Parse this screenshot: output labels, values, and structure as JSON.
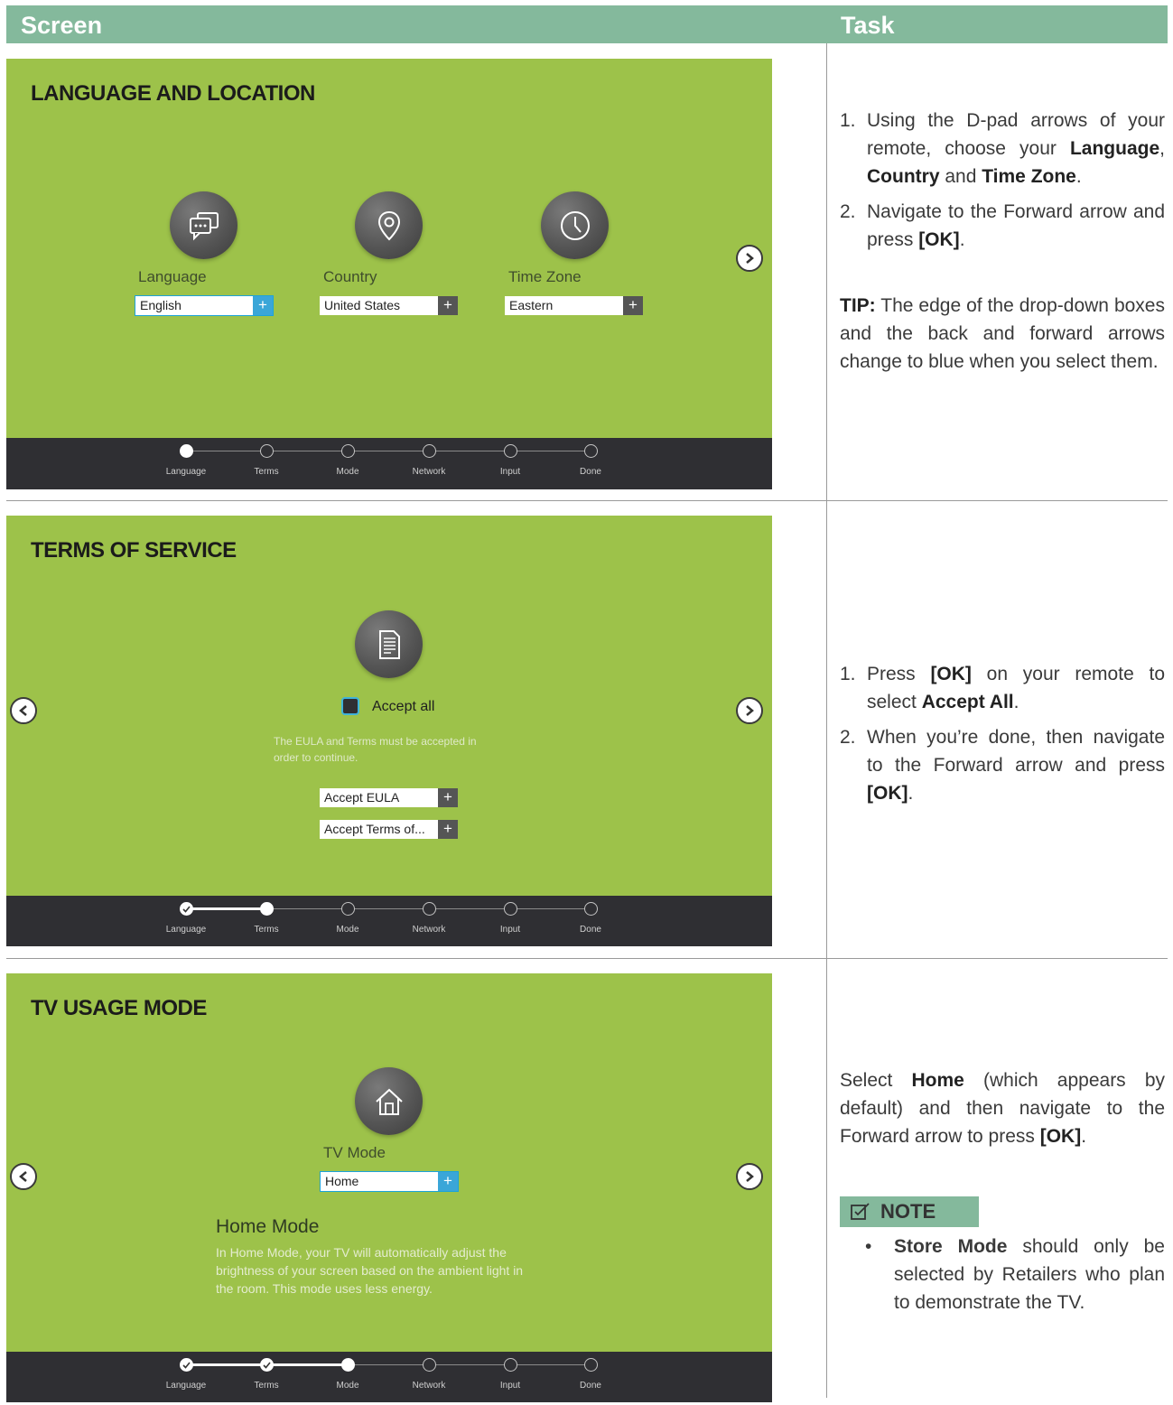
{
  "header": {
    "screen": "Screen",
    "task": "Task"
  },
  "steps": [
    "Language",
    "Terms",
    "Mode",
    "Network",
    "Input",
    "Done"
  ],
  "section1": {
    "title": "LANGUAGE AND LOCATION",
    "fields": [
      {
        "label": "Language",
        "value": "English",
        "icon": "chat-bubbles-icon"
      },
      {
        "label": "Country",
        "value": "United States",
        "icon": "location-pin-icon"
      },
      {
        "label": "Time Zone",
        "value": "Eastern",
        "icon": "clock-icon"
      }
    ],
    "progress_step": 1,
    "task": {
      "step1_num": "1.",
      "step1_a": "Using the D-pad arrows of your remote, choose your ",
      "step1_b1": "Language",
      "step1_c": ", ",
      "step1_b2": "Country",
      "step1_d": " and ",
      "step1_b3": "Time Zone",
      "step1_e": ".",
      "step2_num": "2.",
      "step2_a": "Navigate to the Forward arrow and press ",
      "step2_b": "[OK]",
      "step2_c": ".",
      "tip_label": "TIP:",
      "tip_text": " The edge of the drop-down boxes and the back and forward arrows change to blue when you select them."
    }
  },
  "section2": {
    "title": "TERMS OF SERVICE",
    "accept_all": "Accept all",
    "note_line1": "The EULA and Terms must be accepted in",
    "note_line2": "order to continue.",
    "eula": "Accept EULA",
    "terms": "Accept Terms of...",
    "progress_step": 2,
    "task": {
      "step1_num": "1.",
      "step1_a": "Press ",
      "step1_b": "[OK]",
      "step1_c": " on your remote to select ",
      "step1_d": "Accept All",
      "step1_e": ".",
      "step2_num": "2.",
      "step2_a": "When you’re done, then navigate to the Forward arrow and press ",
      "step2_b": "[OK]",
      "step2_c": "."
    }
  },
  "section3": {
    "title": "TV USAGE MODE",
    "mode_label": "TV Mode",
    "mode_value": "Home",
    "home_title": "Home Mode",
    "home_line1": "In Home Mode, your TV will automatically adjust the",
    "home_line2": "brightness of your screen based on the ambient light in",
    "home_line3": "the room. This mode uses less energy.",
    "progress_step": 3,
    "task": {
      "a": "Select ",
      "b": "Home",
      "c": " (which appears by default) and then navigate to the Forward arrow to press ",
      "d": "[OK]",
      "e": "."
    },
    "note_label": "NOTE",
    "note_bullet": "•",
    "note_bold": "Store Mode",
    "note_text": " should only be selected by Retailers who plan to demonstrate the TV."
  }
}
